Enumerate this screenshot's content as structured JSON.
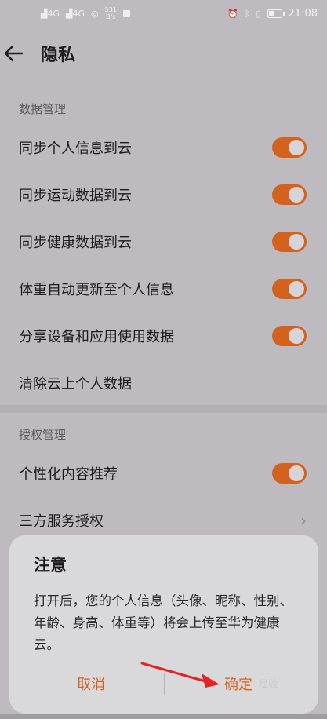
{
  "statusbar": {
    "net1": "4G",
    "net2": "4G",
    "speed": "531\nB/s",
    "time": "21:08",
    "icons": [
      "signal-icon",
      "wifi-icon",
      "alarm-icon",
      "bluetooth-icon",
      "vibrate-icon",
      "battery-icon"
    ]
  },
  "header": {
    "title": "隐私"
  },
  "sections": {
    "data_mgmt": "数据管理",
    "auth_mgmt": "授权管理"
  },
  "rows": [
    {
      "label": "同步个人信息到云",
      "toggle": true
    },
    {
      "label": "同步运动数据到云",
      "toggle": true
    },
    {
      "label": "同步健康数据到云",
      "toggle": true
    },
    {
      "label": "体重自动更新至个人信息",
      "toggle": true
    },
    {
      "label": "分享设备和应用使用数据",
      "toggle": true
    },
    {
      "label": "清除云上个人数据",
      "toggle": null
    },
    {
      "label": "个性化内容推荐",
      "toggle": true
    },
    {
      "label": "三方服务授权",
      "toggle": null
    }
  ],
  "dialog": {
    "title": "注意",
    "message": "打开后，您的个人信息（头像、昵称、性别、年龄、身高、体重等）将会上传至华为健康云。",
    "cancel": "取消",
    "confirm": "确定"
  },
  "watermark": "经验",
  "colors": {
    "accent": "#d4621f",
    "background": "#bdbbbf",
    "dialog": "#d9d8db"
  }
}
